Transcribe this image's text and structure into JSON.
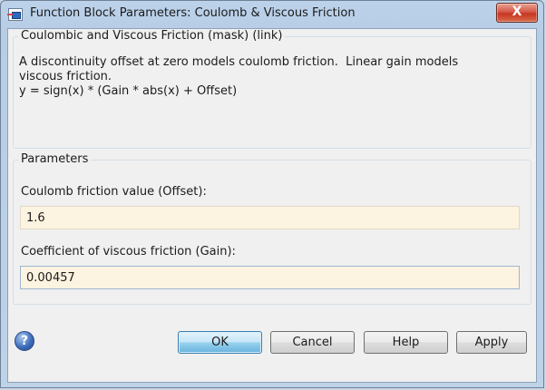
{
  "window": {
    "title": "Function Block Parameters: Coulomb & Viscous Friction",
    "close_glyph": "X",
    "icon": "simulink-block-icon"
  },
  "mask_group": {
    "title": "Coulombic and Viscous Friction (mask) (link)",
    "description_lines": [
      "A discontinuity offset at zero models coulomb friction.  Linear gain models",
      "viscous friction.",
      "y = sign(x) * (Gain * abs(x) + Offset)"
    ]
  },
  "parameters_group": {
    "title": "Parameters",
    "fields": [
      {
        "label": "Coulomb friction value (Offset):",
        "value": "1.6"
      },
      {
        "label": "Coefficient of viscous friction (Gain):",
        "value": "0.00457"
      }
    ]
  },
  "buttons": {
    "help_icon": "help-icon",
    "ok": "OK",
    "cancel": "Cancel",
    "help": "Help",
    "apply": "Apply"
  },
  "colors": {
    "input_background": "#fcf3e0",
    "default_button": "#98d1ef",
    "close_button": "#c7361f"
  }
}
